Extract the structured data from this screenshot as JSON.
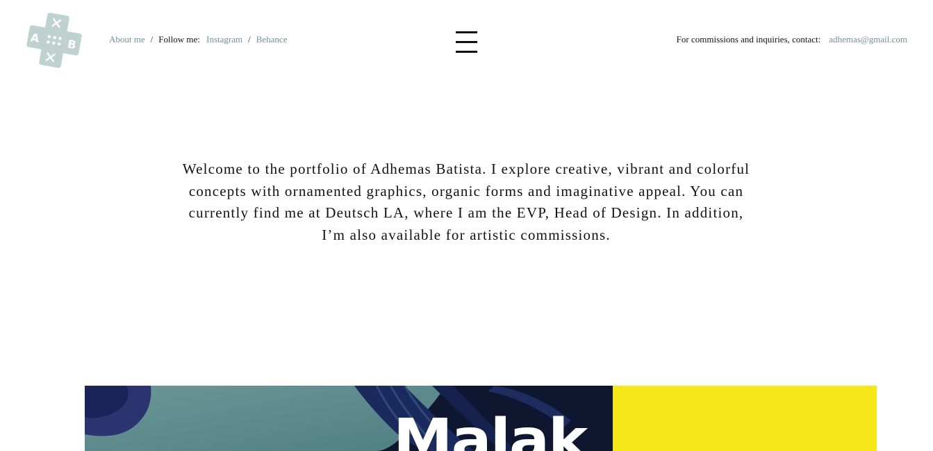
{
  "header": {
    "logo": {
      "icon": "controller-ab-logo-icon",
      "letters": [
        "A",
        "B"
      ],
      "color": "#bfd2d0"
    },
    "nav_left": {
      "about_label": "About me",
      "separator": "/",
      "follow_label": "Follow me:",
      "instagram_label": "Instagram",
      "behance_label": "Behance"
    },
    "menu_icon": "hamburger-menu-icon",
    "contact": {
      "label": "For commissions and inquiries, contact:",
      "email": "adhemas@gmail.com"
    }
  },
  "intro": {
    "text": "Welcome to the portfolio of Adhemas Batista. I explore creative, vibrant and colorful concepts with ornamented graphics, organic forms and imaginative appeal. You can currently find me at Deutsch LA, where I am the EVP, Head of Design. In addition, I’m also available for artistic commissions."
  },
  "projects": [
    {
      "title": "Malak",
      "bg_color": "#0e1630"
    },
    {
      "title": "",
      "bg_color": "#f5e71a"
    }
  ],
  "colors": {
    "link": "#6f9298",
    "text": "#111111",
    "accent_yellow": "#f5e71a",
    "tile_navy": "#0e1630",
    "tile_teal": "#5f8c8e"
  }
}
